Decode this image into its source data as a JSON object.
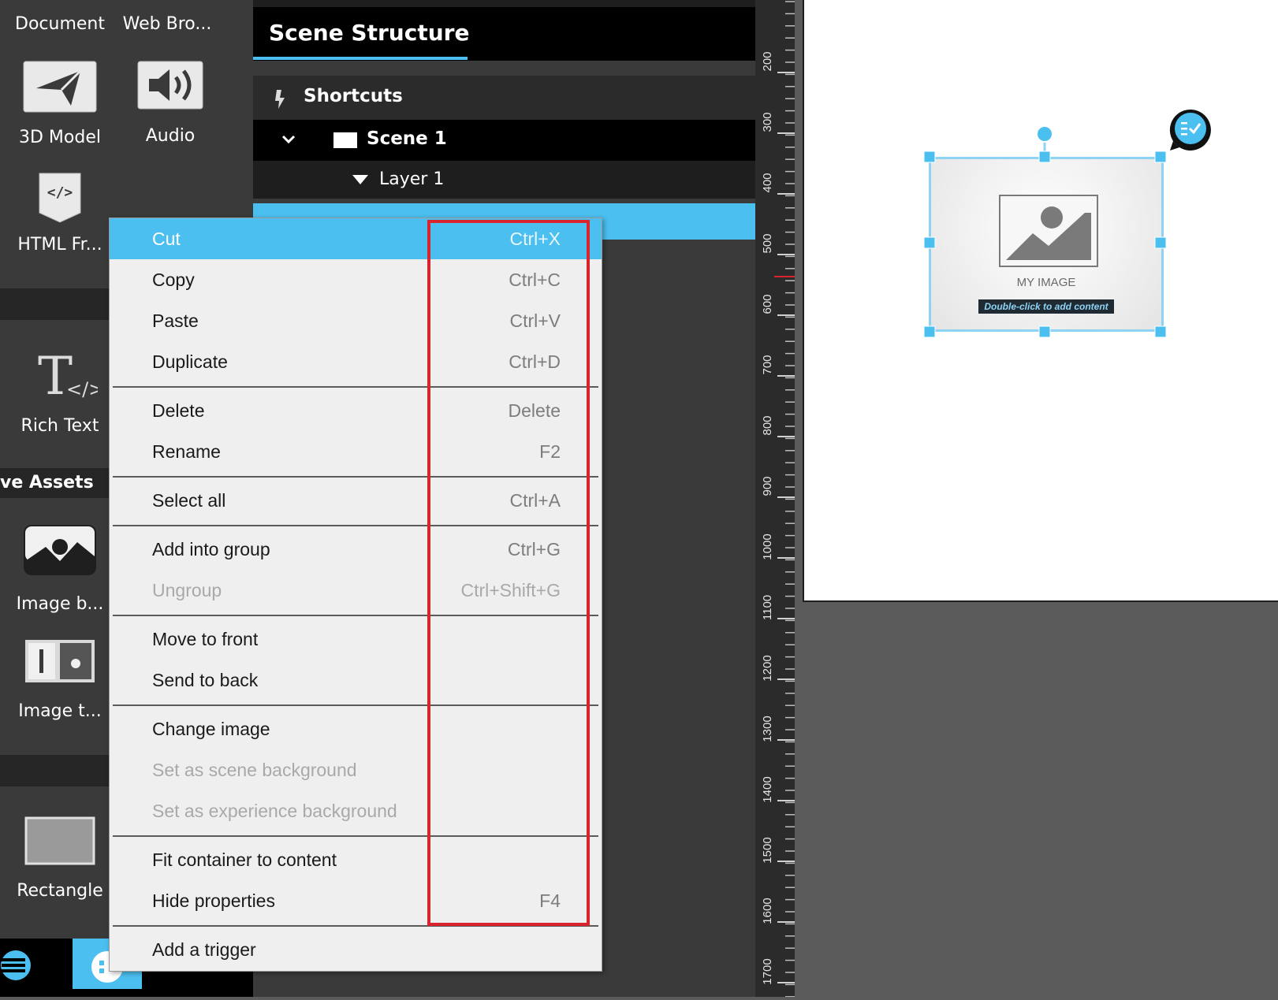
{
  "assets": {
    "document": "Document",
    "web_browser": "Web Bro...",
    "model_3d": "3D Model",
    "audio": "Audio",
    "html_frame": "HTML Fr...",
    "rich_text": "Rich Text",
    "section_title": "ve Assets",
    "image_background": "Image b...",
    "image_text": "Image t...",
    "rectangle": "Rectangle"
  },
  "scene_structure": {
    "title": "Scene Structure",
    "shortcuts": "Shortcuts",
    "scene": "Scene 1",
    "layer": "Layer 1"
  },
  "ruler": {
    "ticks": [
      "200",
      "300",
      "400",
      "500",
      "600",
      "700",
      "800",
      "900",
      "1000",
      "1100",
      "1200",
      "1300",
      "1400",
      "1500",
      "1600",
      "1700"
    ]
  },
  "canvas": {
    "image_label": "MY IMAGE",
    "image_hint": "Double-click to add content"
  },
  "context_menu": {
    "items": [
      {
        "label": "Cut",
        "shortcut": "Ctrl+X"
      },
      {
        "label": "Copy",
        "shortcut": "Ctrl+C"
      },
      {
        "label": "Paste",
        "shortcut": "Ctrl+V"
      },
      {
        "label": "Duplicate",
        "shortcut": "Ctrl+D"
      },
      {
        "label": "Delete",
        "shortcut": "Delete"
      },
      {
        "label": "Rename",
        "shortcut": "F2"
      },
      {
        "label": "Select all",
        "shortcut": "Ctrl+A"
      },
      {
        "label": "Add into group",
        "shortcut": "Ctrl+G"
      },
      {
        "label": "Ungroup",
        "shortcut": "Ctrl+Shift+G"
      },
      {
        "label": "Move to front",
        "shortcut": ""
      },
      {
        "label": "Send to back",
        "shortcut": ""
      },
      {
        "label": "Change image",
        "shortcut": ""
      },
      {
        "label": "Set as scene background",
        "shortcut": ""
      },
      {
        "label": "Set as experience background",
        "shortcut": ""
      },
      {
        "label": "Fit container to content",
        "shortcut": ""
      },
      {
        "label": "Hide properties",
        "shortcut": "F4"
      },
      {
        "label": "Add a trigger",
        "shortcut": ""
      }
    ]
  },
  "colors": {
    "accent": "#4bbff0",
    "highlight_box": "#d9232d",
    "panel_dark": "#3a3a3a"
  },
  "icons": [
    "document-icon",
    "web-browser-icon",
    "3d-model-icon",
    "audio-icon",
    "html-frame-icon",
    "rich-text-icon",
    "image-background-icon",
    "image-text-icon",
    "rectangle-icon",
    "menu-icon",
    "shortcuts-icon",
    "chevron-down-icon",
    "scene-icon",
    "triangle-down-icon",
    "image-placeholder-icon",
    "checklist-badge-icon"
  ]
}
